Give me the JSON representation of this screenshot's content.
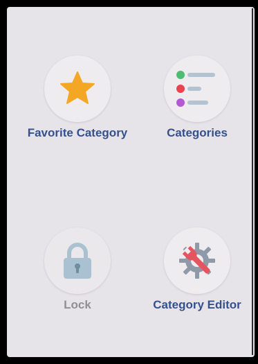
{
  "tiles": [
    {
      "label": "Favorite Category",
      "icon": "star-icon",
      "color": "#f4a724"
    },
    {
      "label": "Categories",
      "icon": "category-list-icon",
      "colors": [
        "#4cbd72",
        "#e8434f",
        "#b458d6",
        "#b4c3d2"
      ]
    },
    {
      "label": "Lock",
      "icon": "lock-icon",
      "color": "#a9c1d0",
      "disabled": true
    },
    {
      "label": "Category Editor",
      "icon": "gear-wrench-icon",
      "colors": [
        "#8e9aa8",
        "#e35660"
      ]
    }
  ]
}
